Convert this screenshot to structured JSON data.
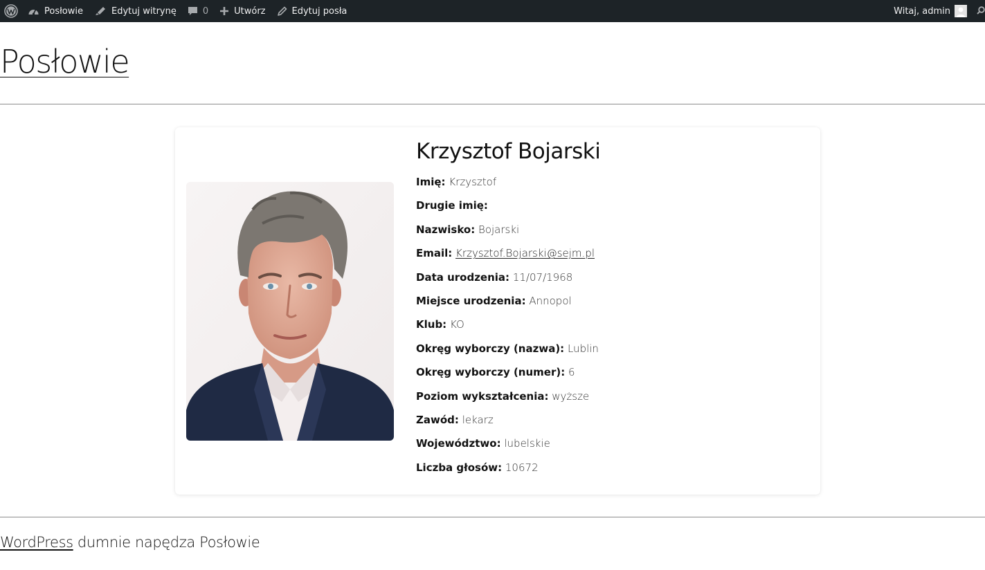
{
  "adminbar": {
    "site_name": "Posłowie",
    "edit_site": "Edytuj witrynę",
    "comments_count": "0",
    "new_label": "Utwórz",
    "edit_post": "Edytuj posła",
    "greeting": "Witaj, admin"
  },
  "header": {
    "site_title": "Posłowie"
  },
  "profile": {
    "name": "Krzysztof Bojarski",
    "fields": [
      {
        "label": "Imię:",
        "value": "Krzysztof"
      },
      {
        "label": "Drugie imię:",
        "value": ""
      },
      {
        "label": "Nazwisko:",
        "value": "Bojarski"
      },
      {
        "label": "Email:",
        "value": "Krzysztof.Bojarski@sejm.pl"
      },
      {
        "label": "Data urodzenia:",
        "value": "11/07/1968"
      },
      {
        "label": "Miejsce urodzenia:",
        "value": "Annopol"
      },
      {
        "label": "Klub:",
        "value": "KO"
      },
      {
        "label": "Okręg wyborczy (nazwa):",
        "value": "Lublin"
      },
      {
        "label": "Okręg wyborczy (numer):",
        "value": "6"
      },
      {
        "label": "Poziom wykształcenia:",
        "value": "wyższe"
      },
      {
        "label": "Zawód:",
        "value": "lekarz"
      },
      {
        "label": "Województwo:",
        "value": "lubelskie"
      },
      {
        "label": "Liczba głosów:",
        "value": "10672"
      }
    ]
  },
  "footer": {
    "wp_link": "WordPress",
    "text": " dumnie napędza Posłowie"
  },
  "colors": {
    "adminbar_bg": "#1d2327",
    "adminbar_text": "#f0f0f1",
    "divider": "#8c8c8c"
  },
  "icons": [
    "wordpress-logo-icon",
    "dashboard-icon",
    "customize-brush-icon",
    "comment-icon",
    "plus-icon",
    "pencil-icon",
    "user-avatar-icon",
    "search-icon"
  ]
}
